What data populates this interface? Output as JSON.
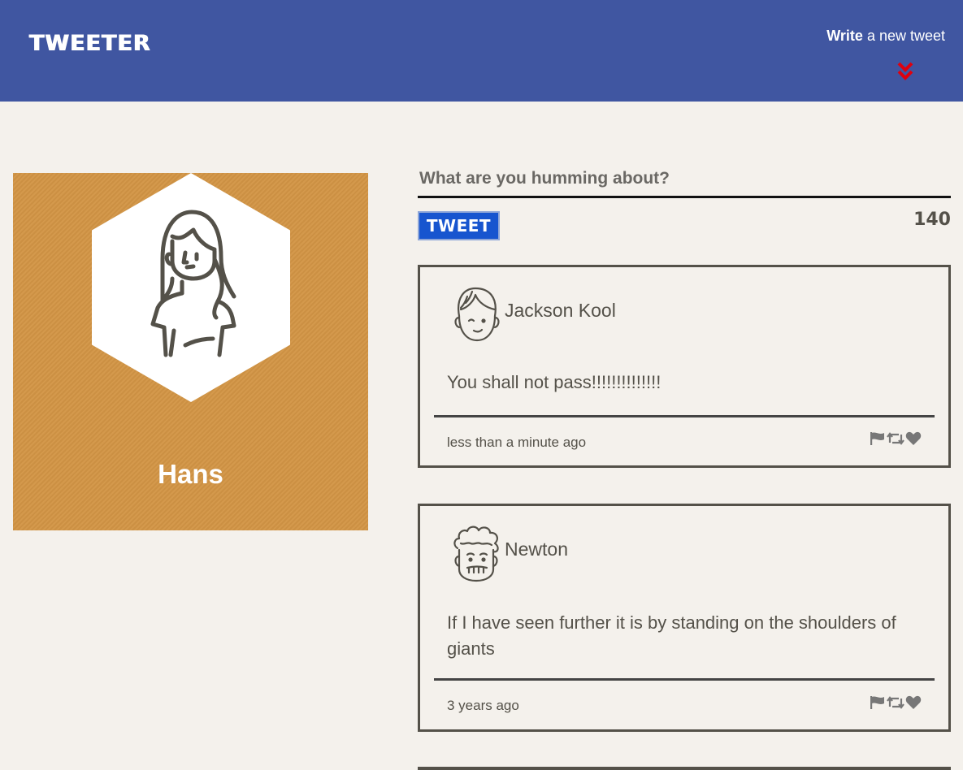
{
  "header": {
    "brand": "TWEETER",
    "compose_bold": "Write",
    "compose_rest": " a new tweet",
    "toggle_icon": "double-chevron-down-icon",
    "colors": {
      "bar": "#4056a1",
      "chevron": "#e0000e"
    }
  },
  "profile": {
    "name": "Hans",
    "avatar_icon": "woman-avatar-icon",
    "colors": {
      "card": "#d29545"
    }
  },
  "composer": {
    "placeholder": "What are you humming about?",
    "button_label": "TWEET",
    "counter": "140",
    "colors": {
      "button": "#1755cf"
    }
  },
  "tweets": [
    {
      "author": "Jackson Kool",
      "avatar_icon": "boy-avatar-icon",
      "text": "You shall not pass!!!!!!!!!!!!!!",
      "time": "less than a minute ago",
      "actions": [
        "flag-icon",
        "retweet-icon",
        "heart-icon"
      ]
    },
    {
      "author": "Newton",
      "avatar_icon": "curly-hair-avatar-icon",
      "text": "If I have seen further it is by standing on the shoulders of giants",
      "time": "3 years ago",
      "actions": [
        "flag-icon",
        "retweet-icon",
        "heart-icon"
      ]
    }
  ]
}
